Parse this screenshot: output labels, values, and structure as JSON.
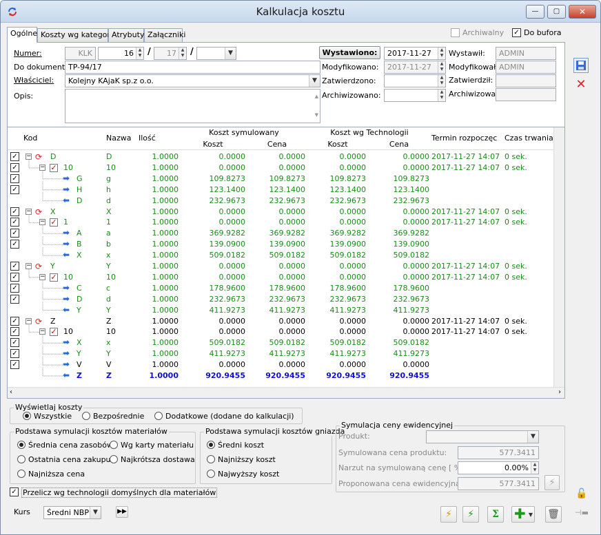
{
  "window": {
    "title": "Kalkulacja kosztu",
    "minimize": "—",
    "maximize": "▢",
    "close": "✕"
  },
  "tabs": [
    "Ogólne",
    "Koszty wg kategorii",
    "Atrybuty",
    "Załączniki"
  ],
  "header": {
    "archiwalny_label": "Archiwalny",
    "do_bufora_label": "Do bufora",
    "numer_label": "Numer:",
    "numer_prefix": "KLK",
    "numer_num": "16",
    "numer_month": "17",
    "sep1": "/",
    "sep2": "/",
    "do_dokumentu_label": "Do dokumentu:",
    "do_dokumentu_value": "TP-94/17",
    "wlasciciel_label": "Właściciel:",
    "wlasciciel_value": "Kolejny KAjaK sp.z o.o.",
    "opis_label": "Opis:",
    "wystawiono_btn": "Wystawiono:",
    "wystawiono_value": "2017-11-27",
    "modyfikowano_label": "Modyfikowano:",
    "modyfikowano_value": "2017-11-27",
    "zatwierdzono_label": "Zatwierdzono:",
    "archiwizowano_label": "Archiwizowano:",
    "wystawil_label": "Wystawił:",
    "wystawil_value": "ADMIN",
    "modyfikowal_label": "Modyfikował:",
    "modyfikowal_value": "ADMIN",
    "zatwierdzil_label": "Zatwierdził:",
    "archiwizowal_label": "Archiwizował:"
  },
  "grid": {
    "columns": {
      "kod": "Kod",
      "nazwa": "Nazwa",
      "ilosc": "Ilość",
      "ks": "Koszt symulowany",
      "kt": "Koszt wg Technologii",
      "koszt": "Koszt",
      "cena": "Cena",
      "termin": "Termin rozpoczęc",
      "czas": "Czas trwania"
    },
    "rows": [
      {
        "lvl": 0,
        "kod": "D",
        "nazwa": "D",
        "ilosc": "1.0000",
        "k1": "0.0000",
        "c1": "0.0000",
        "k2": "0.0000",
        "c2": "0.0000",
        "termin": "2017-11-27 14:07",
        "czas": "0 sek.",
        "style": "green",
        "chk": true
      },
      {
        "lvl": 1,
        "kod": "10",
        "nazwa": "10",
        "ilosc": "1.0000",
        "k1": "0.0000",
        "c1": "0.0000",
        "k2": "0.0000",
        "c2": "0.0000",
        "termin": "2017-11-27 14:07",
        "czas": "0 sek.",
        "style": "green",
        "chk": true
      },
      {
        "lvl": 2,
        "dir": "in",
        "kod": "G",
        "nazwa": "g",
        "ilosc": "1.0000",
        "k1": "109.8273",
        "c1": "109.8273",
        "k2": "109.8273",
        "c2": "109.8273",
        "termin": "",
        "czas": "",
        "style": "green",
        "chk": true
      },
      {
        "lvl": 2,
        "dir": "in",
        "kod": "H",
        "nazwa": "h",
        "ilosc": "1.0000",
        "k1": "123.1400",
        "c1": "123.1400",
        "k2": "123.1400",
        "c2": "123.1400",
        "termin": "",
        "czas": "",
        "style": "green",
        "chk": true
      },
      {
        "lvl": 2,
        "dir": "out",
        "kod": "D",
        "nazwa": "d",
        "ilosc": "1.0000",
        "k1": "232.9673",
        "c1": "232.9673",
        "k2": "232.9673",
        "c2": "232.9673",
        "termin": "",
        "czas": "",
        "style": "green",
        "chk": false
      },
      {
        "lvl": 0,
        "kod": "X",
        "nazwa": "X",
        "ilosc": "1.0000",
        "k1": "0.0000",
        "c1": "0.0000",
        "k2": "0.0000",
        "c2": "0.0000",
        "termin": "2017-11-27 14:07",
        "czas": "0 sek.",
        "style": "green",
        "chk": true
      },
      {
        "lvl": 1,
        "kod": "1",
        "nazwa": "1",
        "ilosc": "1.0000",
        "k1": "0.0000",
        "c1": "0.0000",
        "k2": "0.0000",
        "c2": "0.0000",
        "termin": "2017-11-27 14:07",
        "czas": "0 sek.",
        "style": "green",
        "chk": true
      },
      {
        "lvl": 2,
        "dir": "in",
        "kod": "A",
        "nazwa": "a",
        "ilosc": "1.0000",
        "k1": "369.9282",
        "c1": "369.9282",
        "k2": "369.9282",
        "c2": "369.9282",
        "termin": "",
        "czas": "",
        "style": "green",
        "chk": true
      },
      {
        "lvl": 2,
        "dir": "in",
        "kod": "B",
        "nazwa": "b",
        "ilosc": "1.0000",
        "k1": "139.0900",
        "c1": "139.0900",
        "k2": "139.0900",
        "c2": "139.0900",
        "termin": "",
        "czas": "",
        "style": "green",
        "chk": true
      },
      {
        "lvl": 2,
        "dir": "out",
        "kod": "X",
        "nazwa": "x",
        "ilosc": "1.0000",
        "k1": "509.0182",
        "c1": "509.0182",
        "k2": "509.0182",
        "c2": "509.0182",
        "termin": "",
        "czas": "",
        "style": "green",
        "chk": false
      },
      {
        "lvl": 0,
        "kod": "Y",
        "nazwa": "Y",
        "ilosc": "1.0000",
        "k1": "0.0000",
        "c1": "0.0000",
        "k2": "0.0000",
        "c2": "0.0000",
        "termin": "2017-11-27 14:07",
        "czas": "0 sek.",
        "style": "green",
        "chk": true
      },
      {
        "lvl": 1,
        "kod": "10",
        "nazwa": "10",
        "ilosc": "1.0000",
        "k1": "0.0000",
        "c1": "0.0000",
        "k2": "0.0000",
        "c2": "0.0000",
        "termin": "2017-11-27 14:07",
        "czas": "0 sek.",
        "style": "green",
        "chk": true
      },
      {
        "lvl": 2,
        "dir": "in",
        "kod": "C",
        "nazwa": "c",
        "ilosc": "1.0000",
        "k1": "178.9600",
        "c1": "178.9600",
        "k2": "178.9600",
        "c2": "178.9600",
        "termin": "",
        "czas": "",
        "style": "green",
        "chk": true
      },
      {
        "lvl": 2,
        "dir": "in",
        "kod": "D",
        "nazwa": "d",
        "ilosc": "1.0000",
        "k1": "232.9673",
        "c1": "232.9673",
        "k2": "232.9673",
        "c2": "232.9673",
        "termin": "",
        "czas": "",
        "style": "green",
        "chk": true
      },
      {
        "lvl": 2,
        "dir": "out",
        "kod": "Y",
        "nazwa": "Y",
        "ilosc": "1.0000",
        "k1": "411.9273",
        "c1": "411.9273",
        "k2": "411.9273",
        "c2": "411.9273",
        "termin": "",
        "czas": "",
        "style": "green",
        "chk": false
      },
      {
        "lvl": 0,
        "kod": "Z",
        "nazwa": "Z",
        "ilosc": "1.0000",
        "k1": "0.0000",
        "c1": "0.0000",
        "k2": "0.0000",
        "c2": "0.0000",
        "termin": "2017-11-27 14:07",
        "czas": "0 sek.",
        "style": "black",
        "chk": true
      },
      {
        "lvl": 1,
        "kod": "10",
        "nazwa": "10",
        "ilosc": "1.0000",
        "k1": "0.0000",
        "c1": "0.0000",
        "k2": "0.0000",
        "c2": "0.0000",
        "termin": "2017-11-27 14:07",
        "czas": "0 sek.",
        "style": "black",
        "chk": true
      },
      {
        "lvl": 2,
        "dir": "in",
        "kod": "X",
        "nazwa": "x",
        "ilosc": "1.0000",
        "k1": "509.0182",
        "c1": "509.0182",
        "k2": "509.0182",
        "c2": "509.0182",
        "termin": "",
        "czas": "",
        "style": "green",
        "chk": true
      },
      {
        "lvl": 2,
        "dir": "in",
        "kod": "Y",
        "nazwa": "Y",
        "ilosc": "1.0000",
        "k1": "411.9273",
        "c1": "411.9273",
        "k2": "411.9273",
        "c2": "411.9273",
        "termin": "",
        "czas": "",
        "style": "green",
        "chk": true
      },
      {
        "lvl": 2,
        "dir": "in",
        "kod": "V",
        "nazwa": "V",
        "ilosc": "1.0000",
        "k1": "0.0000",
        "c1": "0.0000",
        "k2": "0.0000",
        "c2": "0.0000",
        "termin": "",
        "czas": "",
        "style": "black",
        "chk": true
      },
      {
        "lvl": 2,
        "dir": "out",
        "kod": "Z",
        "nazwa": "Z",
        "ilosc": "1.0000",
        "k1": "920.9455",
        "c1": "920.9455",
        "k2": "920.9455",
        "c2": "920.9455",
        "termin": "",
        "czas": "",
        "style": "blue",
        "chk": false
      }
    ]
  },
  "options": {
    "wyswietlaj_title": "Wyświetlaj koszty",
    "wszystkie": "Wszystkie",
    "bezposrednie": "Bezpośrednie",
    "dodatkowe": "Dodatkowe (dodane do kalkulacji)",
    "mat_title": "Podstawa symulacji kosztów materiałów",
    "srednia_cena": "Średnia cena zasobów",
    "wg_karty": "Wg karty materiału",
    "ostatnia_cena": "Ostatnia cena zakupu",
    "najkrotsza": "Najkrótsza dostawa",
    "najnizsza_cena": "Najniższa cena",
    "gn_title": "Podstawa symulacji kosztów gniazda",
    "sredni_koszt": "Średni koszt",
    "najnizszy_koszt": "Najniższy koszt",
    "najwyzszy_koszt": "Najwyższy koszt",
    "przelicz": "Przelicz wg technologii domyślnych dla materiałów",
    "kurs_label": "Kurs",
    "kurs_value": "Średni NBP"
  },
  "sim": {
    "title": "Symulacja ceny ewidencyjnej",
    "produkt_label": "Produkt:",
    "sym_cena_label": "Symulowana cena produktu:",
    "sym_cena_value": "577.3411",
    "narzut_label": "Narzut na symulowaną cenę [ % ]:",
    "narzut_value": "0.00%",
    "proponowana_label": "Proponowana cena ewidencyjna:",
    "proponowana_value": "577.3411"
  }
}
